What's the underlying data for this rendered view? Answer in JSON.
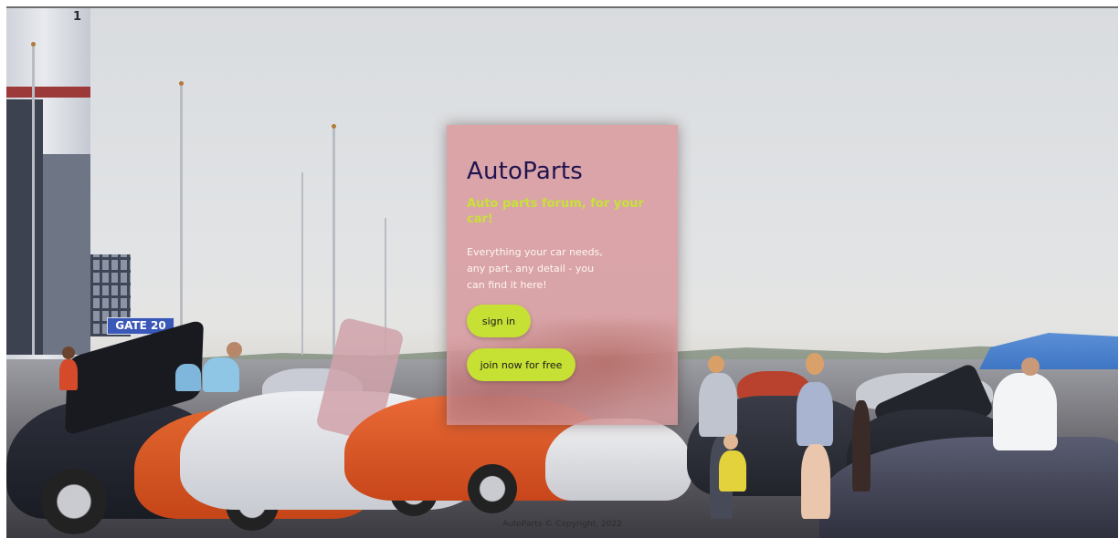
{
  "background": {
    "building_number": "1",
    "gate_sign": "GATE 20"
  },
  "card": {
    "title": "AutoParts",
    "subtitle": "Auto parts forum, for your car!",
    "description": "Everything your car needs, any part, any detail - you can find it here!",
    "sign_in_label": "sign in",
    "join_label": "join now for free"
  },
  "footer": {
    "copyright": "AutoParts © Copyright, 2022"
  },
  "colors": {
    "card_bg": "#dba3a6",
    "title": "#1f1450",
    "subtitle": "#c9e03a",
    "button": "#c7e034"
  }
}
